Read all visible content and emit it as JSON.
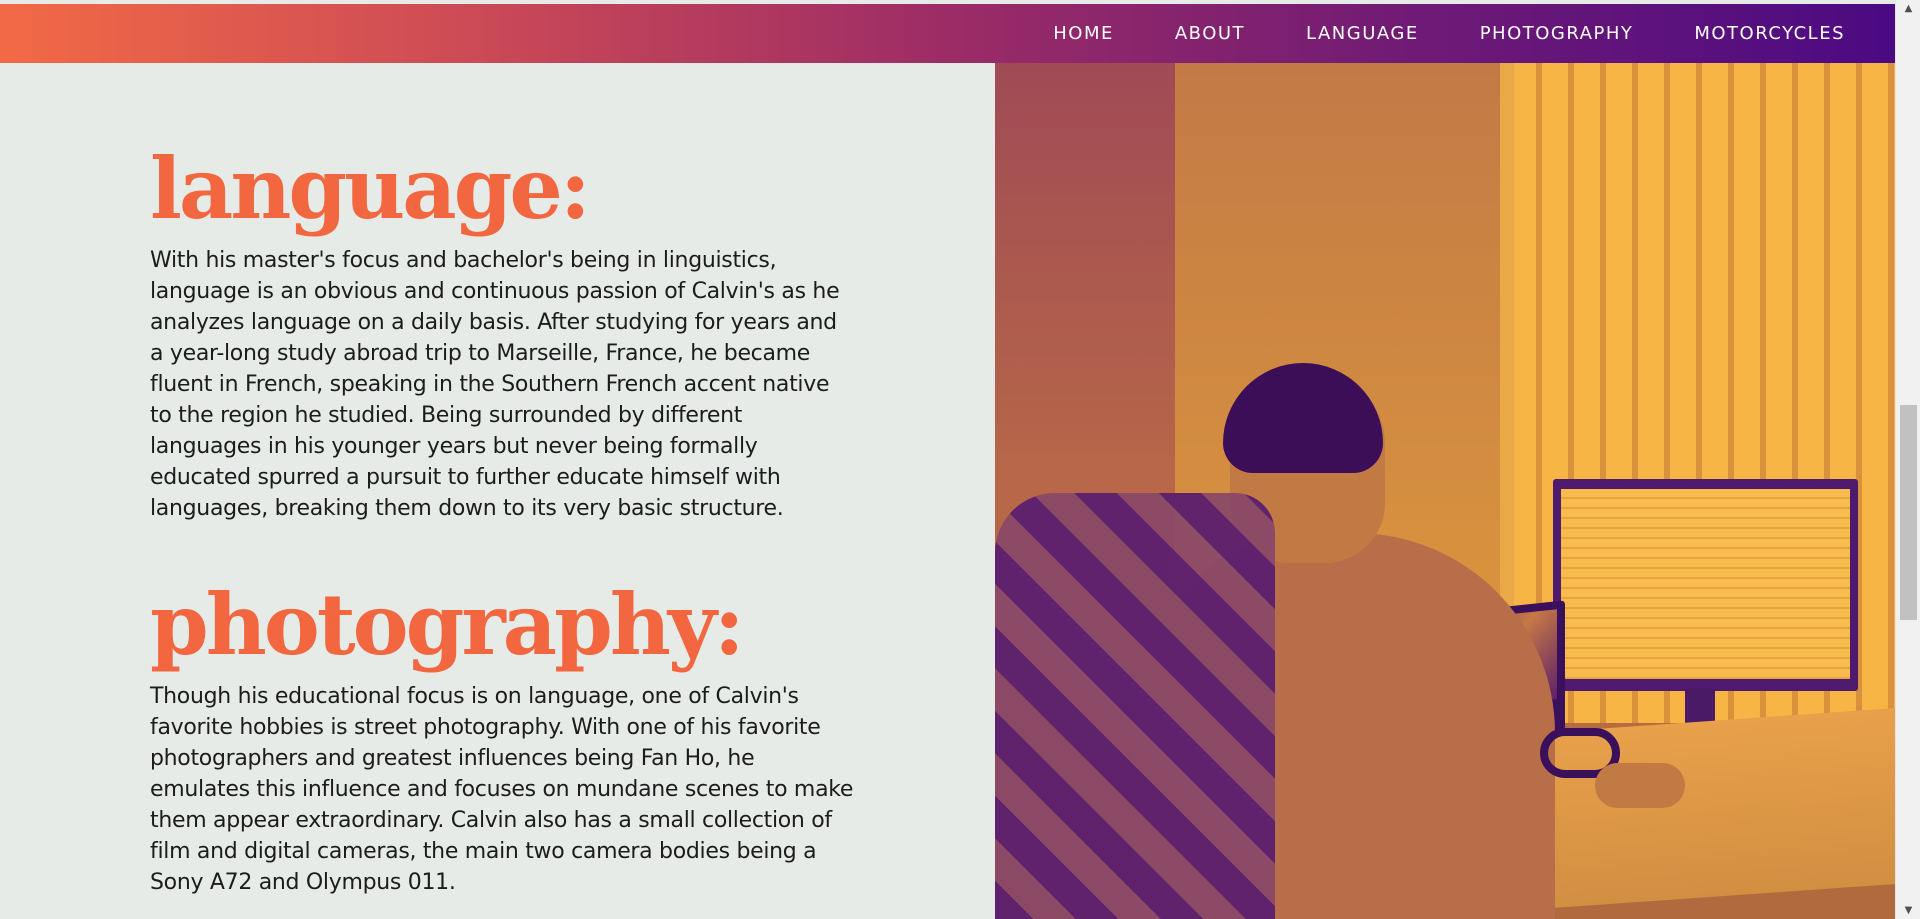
{
  "nav": {
    "items": [
      {
        "label": "HOME"
      },
      {
        "label": "ABOUT"
      },
      {
        "label": "LANGUAGE"
      },
      {
        "label": "PHOTOGRAPHY"
      },
      {
        "label": "MOTORCYCLES"
      }
    ]
  },
  "sections": {
    "language": {
      "heading": "language:",
      "body": "With his master's focus and bachelor's being in linguistics, language is an obvious and continuous passion of Calvin's as he analyzes language on a daily basis. After studying for years and a year-long study abroad trip to Marseille, France, he became fluent in French, speaking in the Southern French accent native to the region he studied. Being surrounded by different languages in his younger years but never being formally educated spurred a pursuit to further educate himself with languages, breaking them down to its very basic structure."
    },
    "photography": {
      "heading": "photography:",
      "body": "Though his educational focus is on language, one of Calvin's favorite hobbies is street photography. With one of his favorite photographers and greatest influences being Fan Ho, he emulates this influence and focuses on mundane scenes to make them appear extraordinary. Calvin also has a small collection of film and digital cameras, the main two camera bodies being a Sony A72 and Olympus 011."
    }
  },
  "colors": {
    "heading": "#f2673f",
    "nav_gradient_start": "#f26a45",
    "nav_gradient_end": "#4b0a82",
    "background": "#e6ebe8"
  },
  "scrollbar": {
    "up_icon": "triangle-up-icon",
    "down_icon": "triangle-down-icon"
  }
}
